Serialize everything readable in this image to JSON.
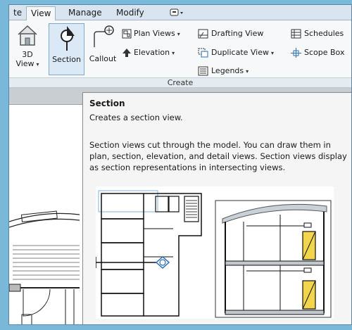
{
  "tabs": [
    {
      "label": "te",
      "active": false
    },
    {
      "label": "View",
      "active": true
    },
    {
      "label": "Manage",
      "active": false
    },
    {
      "label": "Modify",
      "active": false
    }
  ],
  "ribbon": {
    "three_d_view": {
      "line1": "3D",
      "line2": "View"
    },
    "section": {
      "label": "Section"
    },
    "callout": {
      "label": "Callout"
    },
    "plan_views": {
      "label": "Plan Views"
    },
    "elevation": {
      "label": "Elevation"
    },
    "drafting_view": {
      "label": "Drafting View"
    },
    "duplicate_view": {
      "label": "Duplicate View"
    },
    "legends": {
      "label": "Legends"
    },
    "schedules": {
      "label": "Schedules"
    },
    "scope_box": {
      "label": "Scope Box"
    },
    "group_label": "Create"
  },
  "tooltip": {
    "title": "Section",
    "short": "Creates a section view.",
    "long": "Section views cut through the model. You can draw them in plan, section, elevation, and detail views. Section views display as section representations in intersecting views."
  },
  "colors": {
    "background": "#7ab8d9",
    "ribbon": "#f7f8fa",
    "highlight": "#dbe9f7",
    "tooltip": "#f5f5f5",
    "door_fill": "#f2d54a"
  }
}
